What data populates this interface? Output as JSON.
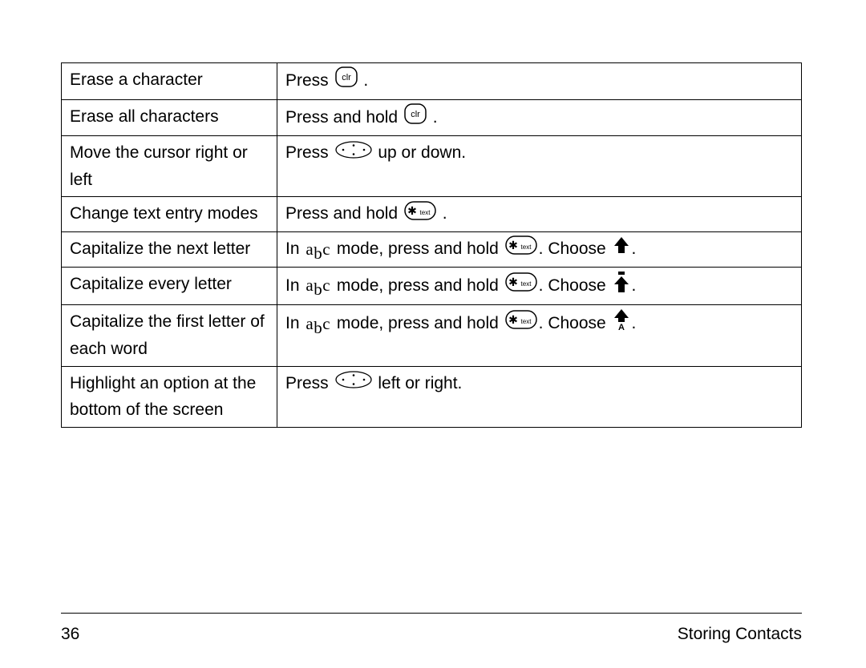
{
  "footer": {
    "page_number": "36",
    "section_title": "Storing Contacts"
  },
  "rows": [
    {
      "left": "Erase a character",
      "right": {
        "parts": [
          "Press ",
          {
            "icon": "clr"
          },
          " ."
        ]
      }
    },
    {
      "left": "Erase all characters",
      "right": {
        "parts": [
          "Press and hold ",
          {
            "icon": "clr"
          },
          " ."
        ]
      }
    },
    {
      "left": "Move the cursor right or left",
      "right": {
        "parts": [
          "Press ",
          {
            "icon": "dpad"
          },
          " up or down."
        ]
      }
    },
    {
      "left": "Change text entry modes",
      "right": {
        "parts": [
          "Press and hold ",
          {
            "icon": "star-text"
          },
          " ."
        ]
      }
    },
    {
      "left": "Capitalize the next letter",
      "right": {
        "parts": [
          "In ",
          {
            "icon": "abc"
          },
          " mode, press and hold ",
          {
            "icon": "star-text"
          },
          ". Choose ",
          {
            "icon": "shift-up"
          },
          "."
        ]
      }
    },
    {
      "left": "Capitalize every letter",
      "right": {
        "parts": [
          "In ",
          {
            "icon": "abc"
          },
          " mode, press and hold ",
          {
            "icon": "star-text"
          },
          ". Choose ",
          {
            "icon": "shift-lock"
          },
          "."
        ]
      }
    },
    {
      "left": "Capitalize the first letter of each word",
      "right": {
        "parts": [
          "In ",
          {
            "icon": "abc"
          },
          " mode, press and hold ",
          {
            "icon": "star-text"
          },
          ". Choose ",
          {
            "icon": "shift-a"
          },
          "."
        ]
      }
    },
    {
      "left": "Highlight an option at the bottom of the screen",
      "right": {
        "parts": [
          "Press ",
          {
            "icon": "dpad"
          },
          " left or right."
        ]
      }
    }
  ]
}
